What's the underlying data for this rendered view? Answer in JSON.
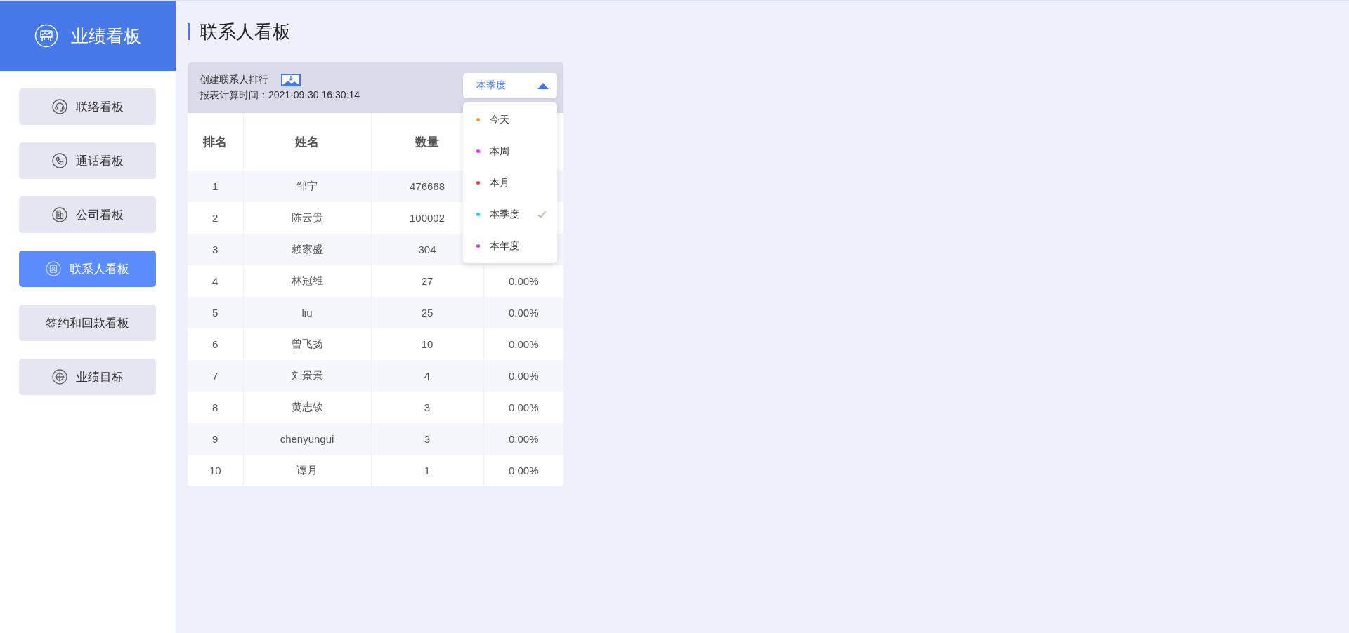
{
  "sidebar": {
    "title": "业绩看板",
    "items": [
      {
        "label": "联络看板",
        "selected": false
      },
      {
        "label": "通话看板",
        "selected": false
      },
      {
        "label": "公司看板",
        "selected": false
      },
      {
        "label": "联系人看板",
        "selected": true
      },
      {
        "label": "签约和回款看板",
        "selected": false
      },
      {
        "label": "业绩目标",
        "selected": false
      }
    ]
  },
  "page_title": "联系人看板",
  "card": {
    "title": "创建联系人排行",
    "calc_time": "报表计算时间：2021-09-30 16:30:14",
    "period_select": {
      "value": "本季度",
      "expanded": true,
      "options": [
        {
          "label": "今天",
          "color": "#f5a142",
          "selected": false
        },
        {
          "label": "本周",
          "color": "#ff1fe8",
          "selected": false
        },
        {
          "label": "本月",
          "color": "#e04040",
          "selected": false
        },
        {
          "label": "本季度",
          "color": "#30c8d8",
          "selected": true
        },
        {
          "label": "本年度",
          "color": "#c040d8",
          "selected": false
        }
      ]
    }
  },
  "table": {
    "columns": [
      "排名",
      "姓名",
      "数量"
    ],
    "rows": [
      [
        "1",
        "邹宁",
        "476668"
      ],
      [
        "2",
        "陈云贵",
        "100002"
      ],
      [
        "3",
        "赖家盛",
        "304"
      ],
      [
        "4",
        "林冠维",
        "27",
        "0.00%"
      ],
      [
        "5",
        "liu",
        "25",
        "0.00%"
      ],
      [
        "6",
        "曾飞扬",
        "10",
        "0.00%"
      ],
      [
        "7",
        "刘景景",
        "4",
        "0.00%"
      ],
      [
        "8",
        "黄志钦",
        "3",
        "0.00%"
      ],
      [
        "9",
        "chenyungui",
        "3",
        "0.00%"
      ],
      [
        "10",
        "谭月",
        "1",
        "0.00%"
      ]
    ]
  }
}
